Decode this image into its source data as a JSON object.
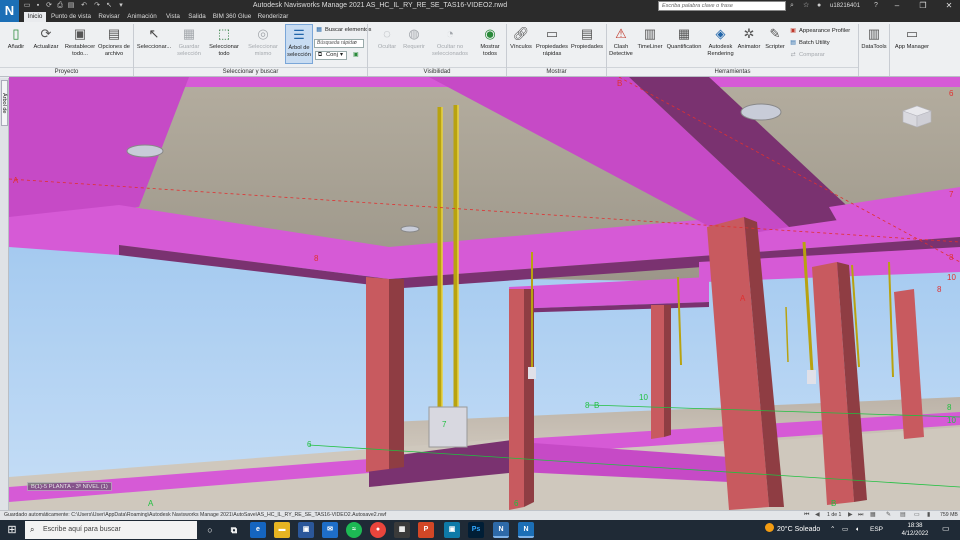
{
  "app": {
    "logo_letter": "N",
    "title": "Autodesk Navisworks Manage 2021    AS_HC_IL_RY_RE_SE_TAS16-VIDEO2.nwd",
    "search_placeholder": "Escriba palabra clave o frase",
    "user": "u18216401"
  },
  "tabs": [
    {
      "label": "Inicio",
      "active": true
    },
    {
      "label": "Punto de vista"
    },
    {
      "label": "Revisar"
    },
    {
      "label": "Animación"
    },
    {
      "label": "Vista"
    },
    {
      "label": "Salida"
    },
    {
      "label": "BIM 360 Glue"
    },
    {
      "label": "Renderizar"
    }
  ],
  "ribbon": {
    "proyecto": {
      "label": "Proyecto",
      "buttons": [
        "Añadir",
        "Actualizar",
        "Restablecer todo...",
        "Opciones de archivo"
      ]
    },
    "seleccionar": {
      "label": "Seleccionar y buscar",
      "buttons": [
        "Seleccionar...",
        "Guardar selección",
        "Seleccionar todo",
        "Seleccionar mismo",
        "Árbol de selección"
      ],
      "find_items": "Buscar elementos",
      "quick_find": "Búsqueda rápida",
      "sets": "Conj"
    },
    "visibilidad": {
      "label": "Visibilidad",
      "buttons": [
        "Ocultar",
        "Requerir",
        "Ocultar no seleccionados",
        "Mostrar todos"
      ]
    },
    "mostrar": {
      "label": "Mostrar",
      "buttons": [
        "Vínculos",
        "Propiedades rápidas",
        "Propiedades"
      ]
    },
    "herramientas": {
      "label": "Herramientas",
      "buttons": [
        "Clash Detective",
        "TimeLiner",
        "Quantification",
        "Autodesk Rendering",
        "Animator",
        "Scripter"
      ],
      "small": [
        "Appearance Profiler",
        "Batch Utility",
        "Comparar"
      ]
    },
    "extra": [
      "DataTools",
      "App Manager"
    ]
  },
  "side_panel": {
    "label": "Árbol de selección"
  },
  "viewport": {
    "view_label": "B(1)-5   PLANTA - 3º NIVEL (1)",
    "grid_labels": [
      "A",
      "B",
      "6",
      "7",
      "8",
      "10",
      "A",
      "6",
      "8",
      "10",
      "8",
      "10",
      "A",
      "B",
      "6",
      "B",
      "7",
      "8",
      "8"
    ]
  },
  "status": {
    "autosave": "Guardado automáticamente: C:\\Users\\User\\AppData\\Roaming\\Autodesk Navisworks Manage 2021\\AutoSave\\AS_HC_IL_RY_RE_SE_TAS16-VIDEO2.Autosave2.nwf",
    "page": "1 de 1",
    "memory": "759 MB"
  },
  "taskbar": {
    "search_placeholder": "Escribe aquí para buscar",
    "weather": "20°C  Soleado",
    "language": "ESP",
    "time": "18:38",
    "date": "4/12/2022"
  },
  "colors": {
    "beam_magenta": "#d65ad6",
    "beam_dark": "#7a3270",
    "column": "#c85a5f",
    "sky": "#9fc9f0",
    "ceiling": "#a8a295",
    "ribbon_bg": "#eef0f2",
    "titlebar": "#2b2b2b"
  }
}
